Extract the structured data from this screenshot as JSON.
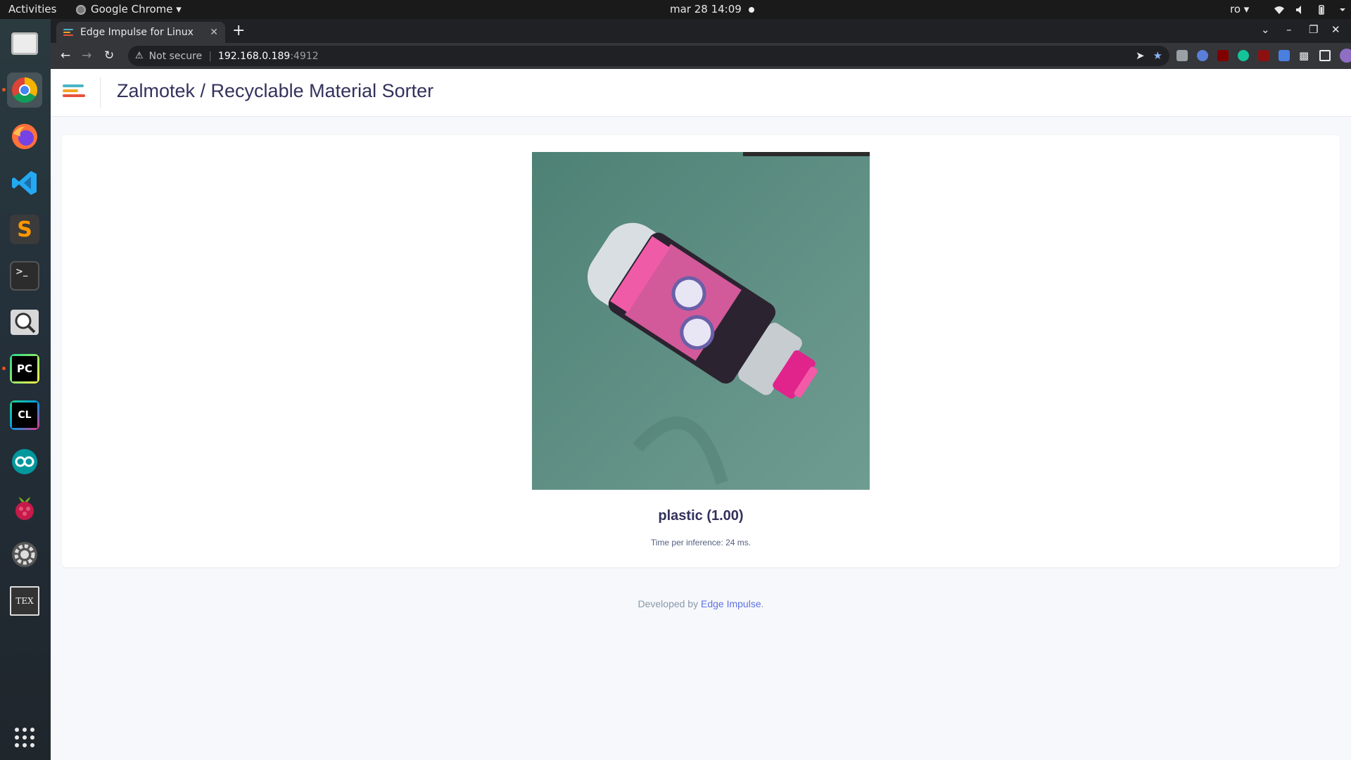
{
  "system": {
    "activities": "Activities",
    "app_menu": "Google Chrome ▾",
    "clock": "mar 28  14:09",
    "lang": "ro ▾"
  },
  "dock": {
    "items": [
      "files",
      "chrome",
      "firefox",
      "vscode",
      "sublime-text",
      "terminal",
      "image-viewer",
      "pycharm",
      "clion",
      "arduino",
      "raspberry-pi",
      "settings",
      "texmaker"
    ],
    "show_apps_icon": "grid-icon"
  },
  "browser": {
    "tab_title": "Edge Impulse for Linux",
    "tab_close": "✕",
    "new_tab": "+",
    "security_label": "Not secure",
    "url_host": "192.168.0.189",
    "url_port": ":4912",
    "back": "←",
    "forward": "→",
    "reload": "↻",
    "window_controls": {
      "menu": "⌄",
      "minimize": "–",
      "maximize": "❐",
      "close": "✕"
    }
  },
  "page": {
    "title": "Zalmotek / Recyclable Material Sorter",
    "classification": "plastic (1.00)",
    "timing": "Time per inference: 24 ms.",
    "footer_prefix": "Developed by ",
    "footer_link": "Edge Impulse",
    "footer_suffix": "."
  },
  "colors": {
    "logo_bars": [
      "#4ab5c4",
      "#f5a623",
      "#e5533d"
    ],
    "accent": "#5e72e4",
    "text_dark": "#32325d"
  }
}
